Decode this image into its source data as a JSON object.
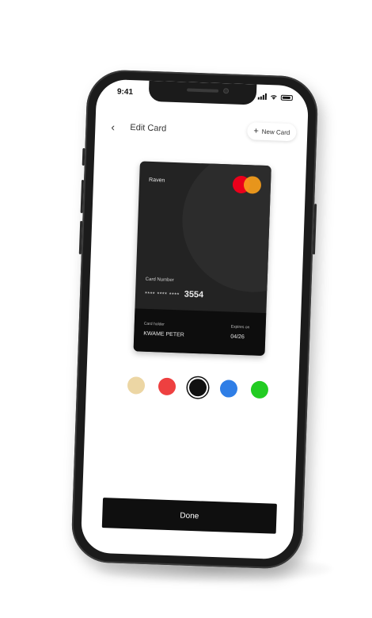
{
  "status_bar": {
    "time": "9:41",
    "icons": [
      "signal-icon",
      "wifi-icon",
      "battery-icon"
    ]
  },
  "header": {
    "back_icon": "chevron-left-icon",
    "title": "Edit Card",
    "new_card_label": "New Card",
    "new_card_icon": "plus-icon"
  },
  "card": {
    "brand": "Raven",
    "network": "mastercard",
    "number_label": "Card Number",
    "number_masked": "**** **** ****",
    "number_last4": "3554",
    "holder_label": "Card holder",
    "holder_name": "KWAME PETER",
    "expiry_label": "Expires on",
    "expiry": "04/26",
    "background_color": "#232323"
  },
  "color_options": [
    {
      "name": "beige",
      "hex": "#ecd6a4",
      "selected": false
    },
    {
      "name": "red",
      "hex": "#ee4040",
      "selected": false
    },
    {
      "name": "black",
      "hex": "#111111",
      "selected": true
    },
    {
      "name": "blue",
      "hex": "#2f7ee6",
      "selected": false
    },
    {
      "name": "green",
      "hex": "#22cc22",
      "selected": false
    }
  ],
  "footer": {
    "done_label": "Done"
  }
}
